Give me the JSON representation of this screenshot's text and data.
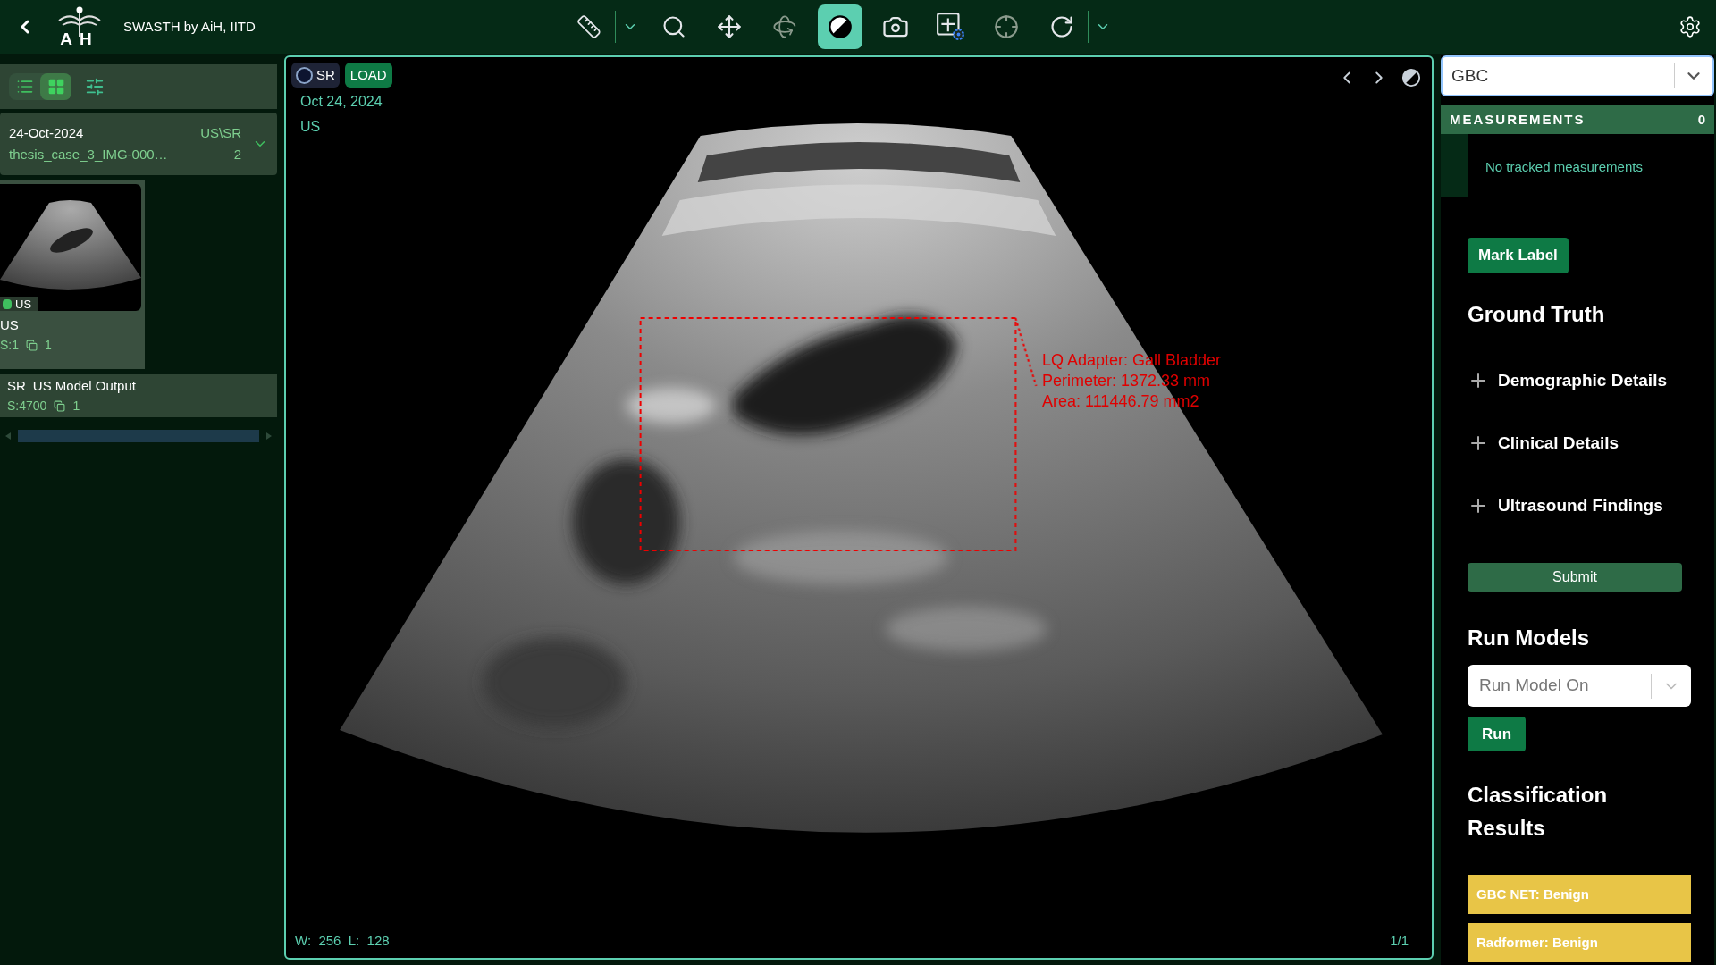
{
  "header": {
    "logo_left": "A",
    "logo_right": "H",
    "title": "SWASTH by AiH, IITD"
  },
  "toolbar": [
    {
      "kind": "ruler",
      "selected": false
    },
    {
      "kind": "caret",
      "selected": false
    },
    {
      "kind": "zoom",
      "selected": false
    },
    {
      "kind": "pan",
      "selected": false
    },
    {
      "kind": "rotate3d",
      "selected": false,
      "disabled": true
    },
    {
      "kind": "contrast",
      "selected": true
    },
    {
      "kind": "camera",
      "selected": false
    },
    {
      "kind": "layout",
      "selected": false
    },
    {
      "kind": "crosshair",
      "selected": false,
      "disabled": true
    },
    {
      "kind": "reset",
      "selected": false
    },
    {
      "kind": "caret",
      "selected": false
    }
  ],
  "left_panel": {
    "view_toggles": [
      {
        "kind": "list",
        "selected": false
      },
      {
        "kind": "grid",
        "selected": true
      },
      {
        "kind": "filter",
        "selected": false
      }
    ],
    "study": {
      "date": "24-Oct-2024",
      "modalities": "US\\SR",
      "description": "thesis_case_3_IMG-000…",
      "count": "2",
      "expanded": true
    },
    "series": [
      {
        "kind": "thumbnail",
        "tag": "US",
        "title": "US",
        "number": "S:1",
        "instances": "1",
        "selected": true
      },
      {
        "kind": "row",
        "tag": "SR",
        "title": "US Model Output",
        "number": "S:4700",
        "instances": "1",
        "selected": false
      }
    ]
  },
  "viewport": {
    "sr_badge": "SR",
    "load_button": "LOAD",
    "date": "Oct 24, 2024",
    "modality": "US",
    "annotation": [
      "LQ Adapter: Gall Bladder",
      "Perimeter: 1372.33 mm",
      "Area: 111446.79 mm2"
    ],
    "window_level": "W:  256  L:  128",
    "frame": "1/1"
  },
  "right_panel": {
    "protocol_select": "GBC",
    "measurements": {
      "title": "MEASUREMENTS",
      "count": "0",
      "empty": "No tracked measurements"
    },
    "mark_label": "Mark Label",
    "ground_truth": {
      "title": "Ground Truth",
      "sections": [
        {
          "label": "Demographic Details",
          "expanded": false
        },
        {
          "label": "Clinical Details",
          "expanded": false
        },
        {
          "label": "Ultrasound Findings",
          "expanded": false
        }
      ],
      "submit": "Submit"
    },
    "run_models": {
      "title": "Run Models",
      "placeholder": "Run Model On",
      "run": "Run"
    },
    "classification": {
      "title": "Classification Results",
      "results": [
        "GBC NET: Benign",
        "Radformer: Benign"
      ]
    }
  }
}
